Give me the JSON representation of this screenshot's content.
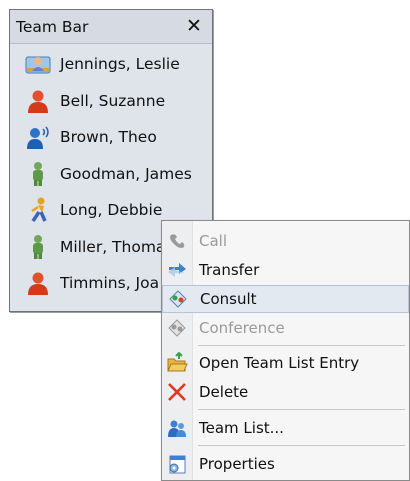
{
  "team_bar": {
    "title": "Team Bar",
    "close_glyph": "✕",
    "members": [
      {
        "name": "Jennings, Leslie",
        "icon": "person-id-card-icon"
      },
      {
        "name": "Bell, Suzanne",
        "icon": "person-red-icon"
      },
      {
        "name": "Brown, Theo",
        "icon": "person-calling-icon"
      },
      {
        "name": "Goodman, James",
        "icon": "person-green-icon"
      },
      {
        "name": "Long, Debbie",
        "icon": "person-walking-icon"
      },
      {
        "name": "Miller, Thoma",
        "icon": "person-green-icon"
      },
      {
        "name": "Timmins, Joa",
        "icon": "person-red-icon"
      }
    ]
  },
  "context_menu": {
    "items": [
      {
        "label": "Call",
        "icon": "handset-icon",
        "enabled": false,
        "mnemonic": "C"
      },
      {
        "label": "Transfer",
        "icon": "transfer-arrows-icon",
        "enabled": true,
        "mnemonic": "T"
      },
      {
        "label": "Consult",
        "icon": "consult-icon",
        "enabled": true,
        "highlighted": true,
        "mnemonic": "o"
      },
      {
        "label": "Conference",
        "icon": "conference-icon",
        "enabled": false,
        "mnemonic": "f"
      },
      {
        "label": "Open Team List Entry",
        "icon": "open-folder-icon",
        "enabled": true,
        "mnemonic": "i"
      },
      {
        "label": "Delete",
        "icon": "delete-x-icon",
        "enabled": true,
        "mnemonic": "D"
      },
      {
        "label": "Team List...",
        "icon": "team-people-icon",
        "enabled": true,
        "mnemonic": "e"
      },
      {
        "label": "Properties",
        "icon": "properties-icon",
        "enabled": true,
        "mnemonic": "t"
      }
    ]
  }
}
